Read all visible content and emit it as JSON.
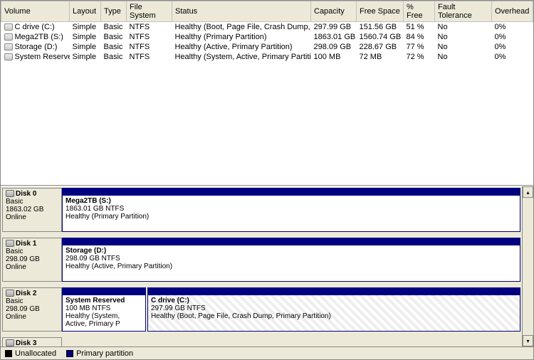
{
  "columns": {
    "volume": "Volume",
    "layout": "Layout",
    "type": "Type",
    "fs": "File System",
    "status": "Status",
    "capacity": "Capacity",
    "free": "Free Space",
    "pct": "% Free",
    "fault": "Fault Tolerance",
    "overhead": "Overhead"
  },
  "volumes": [
    {
      "name": "C drive (C:)",
      "layout": "Simple",
      "type": "Basic",
      "fs": "NTFS",
      "status": "Healthy (Boot, Page File, Crash Dump, Primary Partition)",
      "capacity": "297.99 GB",
      "free": "151.56 GB",
      "pct": "51 %",
      "fault": "No",
      "overhead": "0%"
    },
    {
      "name": "Mega2TB (S:)",
      "layout": "Simple",
      "type": "Basic",
      "fs": "NTFS",
      "status": "Healthy (Primary Partition)",
      "capacity": "1863.01 GB",
      "free": "1560.74 GB",
      "pct": "84 %",
      "fault": "No",
      "overhead": "0%"
    },
    {
      "name": "Storage (D:)",
      "layout": "Simple",
      "type": "Basic",
      "fs": "NTFS",
      "status": "Healthy (Active, Primary Partition)",
      "capacity": "298.09 GB",
      "free": "228.67 GB",
      "pct": "77 %",
      "fault": "No",
      "overhead": "0%"
    },
    {
      "name": "System Reserved",
      "layout": "Simple",
      "type": "Basic",
      "fs": "NTFS",
      "status": "Healthy (System, Active, Primary Partition)",
      "capacity": "100 MB",
      "free": "72 MB",
      "pct": "72 %",
      "fault": "No",
      "overhead": "0%"
    }
  ],
  "disks": [
    {
      "name": "Disk 0",
      "type": "Basic",
      "size": "1863.02 GB",
      "state": "Online",
      "parts": [
        {
          "title": "Mega2TB  (S:)",
          "line2": "1863.01 GB NTFS",
          "line3": "Healthy (Primary Partition)",
          "flex": "1"
        }
      ]
    },
    {
      "name": "Disk 1",
      "type": "Basic",
      "size": "298.09 GB",
      "state": "Online",
      "parts": [
        {
          "title": "Storage  (D:)",
          "line2": "298.09 GB NTFS",
          "line3": "Healthy (Active, Primary Partition)",
          "flex": "1"
        }
      ]
    },
    {
      "name": "Disk 2",
      "type": "Basic",
      "size": "298.09 GB",
      "state": "Online",
      "parts": [
        {
          "title": "System Reserved",
          "line2": "100 MB NTFS",
          "line3": "Healthy (System, Active, Primary P",
          "flex": "0 0 118px"
        },
        {
          "title": "C drive  (C:)",
          "line2": "297.99 GB NTFS",
          "line3": "Healthy (Boot, Page File, Crash Dump, Primary Partition)",
          "flex": "1",
          "hatch": "1"
        }
      ]
    },
    {
      "name": "Disk 3",
      "short": "1"
    }
  ],
  "legend": {
    "unallocated": "Unallocated",
    "primary": "Primary partition"
  }
}
